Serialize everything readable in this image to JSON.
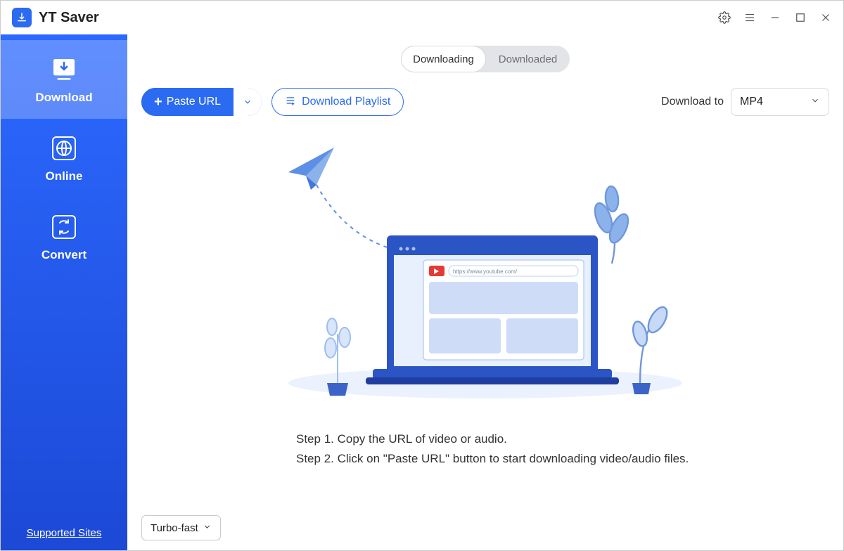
{
  "app": {
    "title": "YT Saver"
  },
  "tabs": {
    "downloading": "Downloading",
    "downloaded": "Downloaded"
  },
  "sidebar": {
    "items": [
      {
        "label": "Download"
      },
      {
        "label": "Online"
      },
      {
        "label": "Convert"
      }
    ],
    "supported": "Supported Sites"
  },
  "actions": {
    "paste_url": "Paste URL",
    "download_playlist": "Download Playlist",
    "download_to_label": "Download to",
    "format_value": "MP4"
  },
  "illustration": {
    "url_text": "https://www.youtube.com/"
  },
  "steps": {
    "step1": "Step 1. Copy the URL of video or audio.",
    "step2": "Step 2. Click on \"Paste URL\" button to start downloading video/audio files."
  },
  "speed": {
    "label": "Turbo-fast"
  },
  "colors": {
    "primary": "#2b6bf2"
  }
}
